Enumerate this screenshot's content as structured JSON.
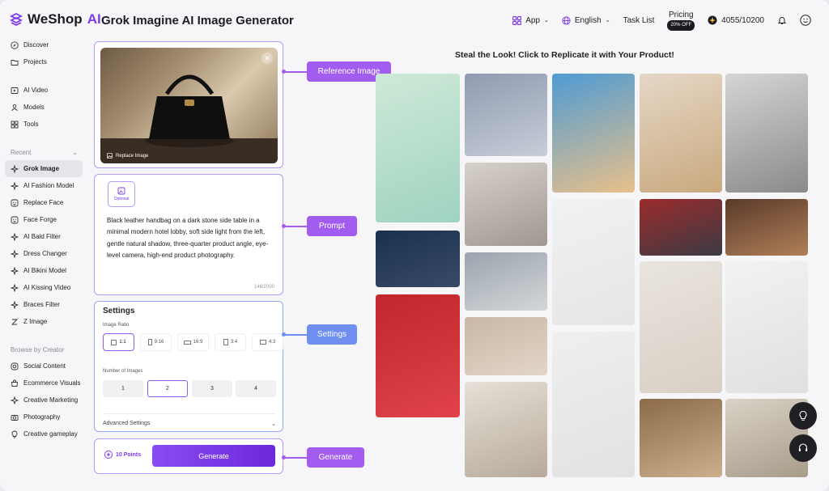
{
  "app": {
    "brand": "WeShop",
    "brand_ai": "AI",
    "title": "Grok Imagine AI Image Generator"
  },
  "topnav": {
    "app": "App",
    "language": "English",
    "task_list": "Task List",
    "pricing": "Pricing",
    "pricing_badge": "20% OFF",
    "credits": "4055/10200"
  },
  "sidebar": {
    "top": [
      {
        "label": "Discover",
        "icon": "compass-icon"
      },
      {
        "label": "Projects",
        "icon": "folder-icon"
      }
    ],
    "tools": [
      {
        "label": "AI Video",
        "icon": "video-icon"
      },
      {
        "label": "Models",
        "icon": "models-icon"
      },
      {
        "label": "Tools",
        "icon": "grid-icon"
      }
    ],
    "recent_label": "Recent",
    "recent": [
      {
        "label": "Grok Image",
        "icon": "sparkle-icon",
        "active": true
      },
      {
        "label": "AI Fashion Model",
        "icon": "sparkle-icon"
      },
      {
        "label": "Replace Face",
        "icon": "face-icon"
      },
      {
        "label": "Face Forge",
        "icon": "face-icon"
      },
      {
        "label": "AI Bald Filter",
        "icon": "sparkle-icon"
      },
      {
        "label": "Dress Changer",
        "icon": "sparkle-icon"
      },
      {
        "label": "AI Bikini Model",
        "icon": "sparkle-icon"
      },
      {
        "label": "AI Kissing Video",
        "icon": "sparkle-icon"
      },
      {
        "label": "Braces Filter",
        "icon": "sparkle-icon"
      },
      {
        "label": "Z Image",
        "icon": "z-icon"
      }
    ],
    "creator_label": "Browse by Creator",
    "creator": [
      {
        "label": "Social Content",
        "icon": "social-icon"
      },
      {
        "label": "Ecommerce Visuals",
        "icon": "shop-icon"
      },
      {
        "label": "Creative Marketing",
        "icon": "marketing-icon"
      },
      {
        "label": "Photography",
        "icon": "camera-icon"
      },
      {
        "label": "Creative gameplay",
        "icon": "bulb-icon"
      }
    ]
  },
  "reference": {
    "replace_label": "Replace Image"
  },
  "prompt": {
    "optional": "Optional",
    "text": "Black leather handbag on a dark stone side table in a minimal modern hotel lobby, soft side light from the left, gentle natural shadow, three-quarter product angle, eye-level camera, high-end product photography.",
    "counter": "146/2000"
  },
  "settings": {
    "title": "Settings",
    "ratio_label": "Image Ratio",
    "ratios": [
      "1:1",
      "9:16",
      "16:9",
      "3:4",
      "4:3"
    ],
    "ratio_selected": "1:1",
    "count_label": "Number of Images",
    "counts": [
      "1",
      "2",
      "3",
      "4"
    ],
    "count_selected": "2",
    "advanced": "Advanced Settings"
  },
  "generate": {
    "points": "10 Points",
    "button": "Generate"
  },
  "callouts": {
    "reference": "Reference Image",
    "prompt": "Prompt",
    "settings": "Settings",
    "generate": "Generate"
  },
  "gallery": {
    "heading": "Steal the Look! Click to Replicate it with Your Product!",
    "tiles": [
      {
        "name": "3d-doll-bubbles",
        "colors": [
          "#cfe9d8",
          "#9fd3c0"
        ]
      },
      {
        "name": "toy-figure-stars",
        "colors": [
          "#18314f",
          "#3a4a66"
        ]
      },
      {
        "name": "silver-hair-doll",
        "colors": [
          "#c0262b",
          "#e0434b"
        ]
      },
      {
        "name": "city-building",
        "colors": [
          "#8f9bb0",
          "#c7cdd8"
        ]
      },
      {
        "name": "sofa-mascot",
        "colors": [
          "#d6d1ca",
          "#a09890"
        ]
      },
      {
        "name": "handbag-rocks",
        "colors": [
          "#9aa4ad",
          "#d4d7d9"
        ]
      },
      {
        "name": "street-fashion",
        "colors": [
          "#c9b7a4",
          "#e2d6c8"
        ]
      },
      {
        "name": "hat-portrait",
        "colors": [
          "#e6e0d8",
          "#b7aa9a"
        ]
      },
      {
        "name": "pizza-smile",
        "colors": [
          "#4f9bd3",
          "#e8c08a"
        ]
      },
      {
        "name": "icecream-figure",
        "colors": [
          "#f1f1f1",
          "#e6e6e6"
        ]
      },
      {
        "name": "clay-figure",
        "colors": [
          "#efefef",
          "#e2e2e2"
        ]
      },
      {
        "name": "sofa-selfie",
        "colors": [
          "#e5d7c6",
          "#c9a97e"
        ]
      },
      {
        "name": "red-chair-bag",
        "colors": [
          "#9b2b2b",
          "#3b3b44"
        ]
      },
      {
        "name": "white-top-model",
        "colors": [
          "#e9e4df",
          "#d9cfc4"
        ]
      },
      {
        "name": "mirror-portrait",
        "colors": [
          "#8c6a4a",
          "#cbb08c"
        ]
      },
      {
        "name": "butterfly-portrait",
        "colors": [
          "#d5d5d5",
          "#8a8a8a"
        ]
      },
      {
        "name": "room-mirror",
        "colors": [
          "#5a3a2a",
          "#b08058"
        ]
      },
      {
        "name": "black-vest-model",
        "colors": [
          "#f2f2f2",
          "#e0e0e0"
        ]
      },
      {
        "name": "lace-top-model",
        "colors": [
          "#d9d2c6",
          "#a89c8a"
        ]
      }
    ]
  }
}
